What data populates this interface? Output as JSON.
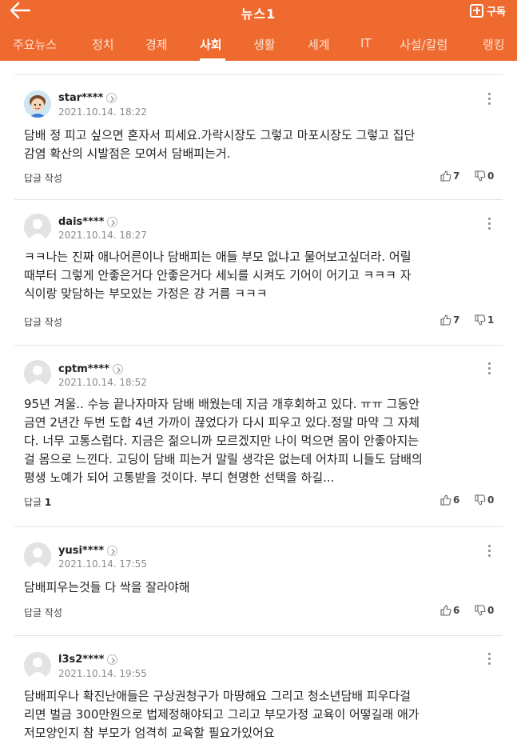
{
  "header": {
    "title": "뉴스1",
    "subscribe_label": "구독",
    "back_icon": "arrow-left-icon",
    "subscribe_icon": "plus-square-icon"
  },
  "tabs": [
    {
      "label": "주요뉴스",
      "active": false
    },
    {
      "label": "정치",
      "active": false
    },
    {
      "label": "경제",
      "active": false
    },
    {
      "label": "사회",
      "active": true
    },
    {
      "label": "생활",
      "active": false
    },
    {
      "label": "세계",
      "active": false
    },
    {
      "label": "IT",
      "active": false
    },
    {
      "label": "사설/칼럼",
      "active": false
    },
    {
      "label": "랭킹",
      "active": false
    }
  ],
  "colors": {
    "brand": "#ee6a2f"
  },
  "comments": [
    {
      "user": "star****",
      "date": "2021.10.14. 18:22",
      "lines": [
        "담배 정 피고 싶으면 혼자서 피세요.가락시장도 그렇고 마포시장도 그렇고 집단",
        "감염 확산의 시발점은 모여서 담배피는거."
      ],
      "reply_label": "답글 작성",
      "reply_count": "",
      "likes": "7",
      "dislikes": "0",
      "avatar": "character-avatar"
    },
    {
      "user": "dais****",
      "date": "2021.10.14. 18:27",
      "lines": [
        "ㅋㅋ나는 진짜 애나어른이나 담배피는 애들 부모 없냐고 물어보고싶더라. 어릴",
        "때부터 그렇게 안좋은거다 안좋은거다 세뇌를 시켜도 기어이 어기고 ㅋㅋㅋ 자",
        "식이랑 맞담하는 부모있는 가정은 걍 거름 ㅋㅋㅋ"
      ],
      "reply_label": "답글 작성",
      "reply_count": "",
      "likes": "7",
      "dislikes": "1",
      "avatar": "default-avatar"
    },
    {
      "user": "cptm****",
      "date": "2021.10.14. 18:52",
      "lines": [
        "95년 겨울.. 수능 끝나자마자 담배 배웠는데 지금 개후회하고 있다. ㅠㅠ 그동안",
        "금연 2년간 두번 도합 4년 가까이 끊었다가 다시 피우고 있다.정말 마약 그 자체",
        "다. 너무 고통스럽다. 지금은 젊으니까 모르겠지만 나이 먹으면 몸이 안좋아지는",
        "걸 몸으로 느낀다. 고딩이 담배 피는거 말릴 생각은 없는데 어차피 니들도 담배의",
        "평생 노예가 되어 고통받을 것이다. 부디 현명한 선택을 하길..."
      ],
      "reply_label": "답글",
      "reply_count": "1",
      "likes": "6",
      "dislikes": "0",
      "avatar": "default-avatar"
    },
    {
      "user": "yusi****",
      "date": "2021.10.14. 17:55",
      "lines": [
        "담배피우는것들 다 싹을 잘라야해"
      ],
      "reply_label": "답글 작성",
      "reply_count": "",
      "likes": "6",
      "dislikes": "0",
      "avatar": "default-avatar"
    },
    {
      "user": "l3s2****",
      "date": "2021.10.14. 19:55",
      "lines": [
        "담배피우나 확진난애들은 구상권청구가 마땅해요 그리고 청소년담배 피우다걸",
        "리면 벌금 300만원으로 법제정해야되고 그리고 부모가정 교육이 어떻길래 애가",
        "저모양인지 참 부모가 엄격히 교육할 필요가있어요"
      ],
      "reply_label": "",
      "reply_count": "",
      "likes": "",
      "dislikes": "",
      "avatar": "default-avatar"
    }
  ]
}
